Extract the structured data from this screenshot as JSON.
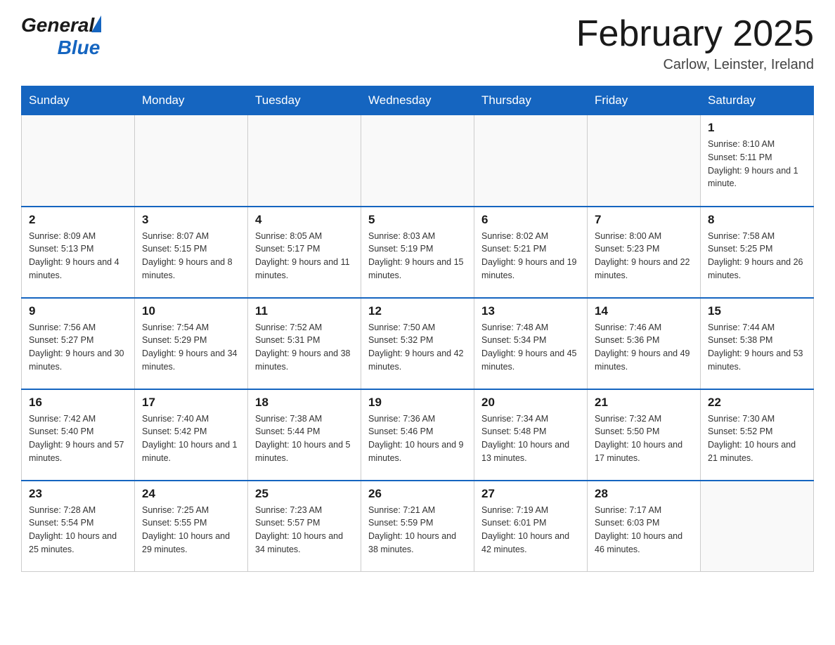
{
  "header": {
    "logo_general": "General",
    "logo_blue": "Blue",
    "month_title": "February 2025",
    "location": "Carlow, Leinster, Ireland"
  },
  "days_of_week": [
    "Sunday",
    "Monday",
    "Tuesday",
    "Wednesday",
    "Thursday",
    "Friday",
    "Saturday"
  ],
  "weeks": [
    [
      {
        "day": "",
        "info": ""
      },
      {
        "day": "",
        "info": ""
      },
      {
        "day": "",
        "info": ""
      },
      {
        "day": "",
        "info": ""
      },
      {
        "day": "",
        "info": ""
      },
      {
        "day": "",
        "info": ""
      },
      {
        "day": "1",
        "info": "Sunrise: 8:10 AM\nSunset: 5:11 PM\nDaylight: 9 hours and 1 minute."
      }
    ],
    [
      {
        "day": "2",
        "info": "Sunrise: 8:09 AM\nSunset: 5:13 PM\nDaylight: 9 hours and 4 minutes."
      },
      {
        "day": "3",
        "info": "Sunrise: 8:07 AM\nSunset: 5:15 PM\nDaylight: 9 hours and 8 minutes."
      },
      {
        "day": "4",
        "info": "Sunrise: 8:05 AM\nSunset: 5:17 PM\nDaylight: 9 hours and 11 minutes."
      },
      {
        "day": "5",
        "info": "Sunrise: 8:03 AM\nSunset: 5:19 PM\nDaylight: 9 hours and 15 minutes."
      },
      {
        "day": "6",
        "info": "Sunrise: 8:02 AM\nSunset: 5:21 PM\nDaylight: 9 hours and 19 minutes."
      },
      {
        "day": "7",
        "info": "Sunrise: 8:00 AM\nSunset: 5:23 PM\nDaylight: 9 hours and 22 minutes."
      },
      {
        "day": "8",
        "info": "Sunrise: 7:58 AM\nSunset: 5:25 PM\nDaylight: 9 hours and 26 minutes."
      }
    ],
    [
      {
        "day": "9",
        "info": "Sunrise: 7:56 AM\nSunset: 5:27 PM\nDaylight: 9 hours and 30 minutes."
      },
      {
        "day": "10",
        "info": "Sunrise: 7:54 AM\nSunset: 5:29 PM\nDaylight: 9 hours and 34 minutes."
      },
      {
        "day": "11",
        "info": "Sunrise: 7:52 AM\nSunset: 5:31 PM\nDaylight: 9 hours and 38 minutes."
      },
      {
        "day": "12",
        "info": "Sunrise: 7:50 AM\nSunset: 5:32 PM\nDaylight: 9 hours and 42 minutes."
      },
      {
        "day": "13",
        "info": "Sunrise: 7:48 AM\nSunset: 5:34 PM\nDaylight: 9 hours and 45 minutes."
      },
      {
        "day": "14",
        "info": "Sunrise: 7:46 AM\nSunset: 5:36 PM\nDaylight: 9 hours and 49 minutes."
      },
      {
        "day": "15",
        "info": "Sunrise: 7:44 AM\nSunset: 5:38 PM\nDaylight: 9 hours and 53 minutes."
      }
    ],
    [
      {
        "day": "16",
        "info": "Sunrise: 7:42 AM\nSunset: 5:40 PM\nDaylight: 9 hours and 57 minutes."
      },
      {
        "day": "17",
        "info": "Sunrise: 7:40 AM\nSunset: 5:42 PM\nDaylight: 10 hours and 1 minute."
      },
      {
        "day": "18",
        "info": "Sunrise: 7:38 AM\nSunset: 5:44 PM\nDaylight: 10 hours and 5 minutes."
      },
      {
        "day": "19",
        "info": "Sunrise: 7:36 AM\nSunset: 5:46 PM\nDaylight: 10 hours and 9 minutes."
      },
      {
        "day": "20",
        "info": "Sunrise: 7:34 AM\nSunset: 5:48 PM\nDaylight: 10 hours and 13 minutes."
      },
      {
        "day": "21",
        "info": "Sunrise: 7:32 AM\nSunset: 5:50 PM\nDaylight: 10 hours and 17 minutes."
      },
      {
        "day": "22",
        "info": "Sunrise: 7:30 AM\nSunset: 5:52 PM\nDaylight: 10 hours and 21 minutes."
      }
    ],
    [
      {
        "day": "23",
        "info": "Sunrise: 7:28 AM\nSunset: 5:54 PM\nDaylight: 10 hours and 25 minutes."
      },
      {
        "day": "24",
        "info": "Sunrise: 7:25 AM\nSunset: 5:55 PM\nDaylight: 10 hours and 29 minutes."
      },
      {
        "day": "25",
        "info": "Sunrise: 7:23 AM\nSunset: 5:57 PM\nDaylight: 10 hours and 34 minutes."
      },
      {
        "day": "26",
        "info": "Sunrise: 7:21 AM\nSunset: 5:59 PM\nDaylight: 10 hours and 38 minutes."
      },
      {
        "day": "27",
        "info": "Sunrise: 7:19 AM\nSunset: 6:01 PM\nDaylight: 10 hours and 42 minutes."
      },
      {
        "day": "28",
        "info": "Sunrise: 7:17 AM\nSunset: 6:03 PM\nDaylight: 10 hours and 46 minutes."
      },
      {
        "day": "",
        "info": ""
      }
    ]
  ]
}
